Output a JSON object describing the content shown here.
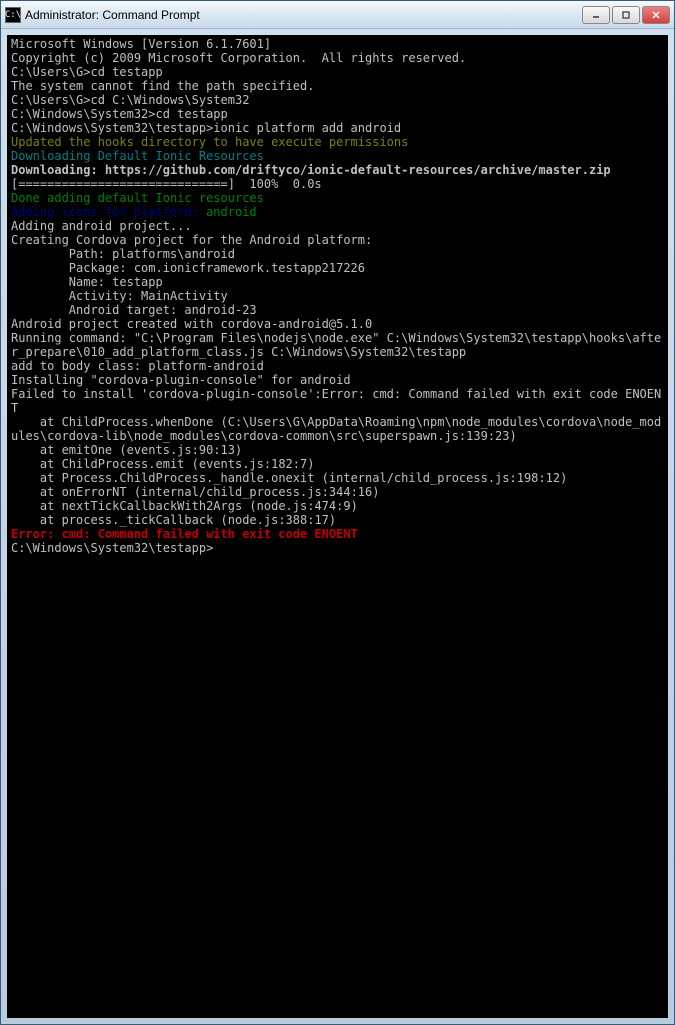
{
  "window": {
    "title": "Administrator: Command Prompt",
    "icon_label": "C:\\"
  },
  "terminal": {
    "lines": [
      {
        "cls": "c-white",
        "text": "Microsoft Windows [Version 6.1.7601]"
      },
      {
        "cls": "c-white",
        "text": "Copyright (c) 2009 Microsoft Corporation.  All rights reserved."
      },
      {
        "cls": "c-white",
        "text": ""
      },
      {
        "cls": "c-white",
        "text": "C:\\Users\\G>cd testapp"
      },
      {
        "cls": "c-white",
        "text": "The system cannot find the path specified."
      },
      {
        "cls": "c-white",
        "text": ""
      },
      {
        "cls": "c-white",
        "text": "C:\\Users\\G>cd C:\\Windows\\System32"
      },
      {
        "cls": "c-white",
        "text": ""
      },
      {
        "cls": "c-white",
        "text": "C:\\Windows\\System32>cd testapp"
      },
      {
        "cls": "c-white",
        "text": ""
      },
      {
        "cls": "c-white",
        "text": "C:\\Windows\\System32\\testapp>ionic platform add android"
      },
      {
        "cls": "c-yellow",
        "text": "Updated the hooks directory to have execute permissions"
      },
      {
        "cls": "c-cyan",
        "text": "Downloading Default Ionic Resources"
      },
      {
        "cls": "c-white bold",
        "text": "Downloading: https://github.com/driftyco/ionic-default-resources/archive/master.zip"
      },
      {
        "cls": "c-white",
        "text": "[=============================]  100%  0.0s"
      },
      {
        "cls": "c-green",
        "text": "Done adding default Ionic resources"
      },
      {
        "cls": "c-blue",
        "parts": [
          {
            "cls": "c-blue",
            "text": "Adding icons for platform: "
          },
          {
            "cls": "c-green",
            "text": "android"
          }
        ]
      },
      {
        "cls": "c-white",
        "text": "Adding android project..."
      },
      {
        "cls": "c-white",
        "text": "Creating Cordova project for the Android platform:"
      },
      {
        "cls": "c-white",
        "text": "        Path: platforms\\android"
      },
      {
        "cls": "c-white",
        "text": "        Package: com.ionicframework.testapp217226"
      },
      {
        "cls": "c-white",
        "text": "        Name: testapp"
      },
      {
        "cls": "c-white",
        "text": "        Activity: MainActivity"
      },
      {
        "cls": "c-white",
        "text": "        Android target: android-23"
      },
      {
        "cls": "c-white",
        "text": "Android project created with cordova-android@5.1.0"
      },
      {
        "cls": "c-white",
        "text": "Running command: \"C:\\Program Files\\nodejs\\node.exe\" C:\\Windows\\System32\\testapp\\hooks\\after_prepare\\010_add_platform_class.js C:\\Windows\\System32\\testapp"
      },
      {
        "cls": "c-white",
        "text": "add to body class: platform-android"
      },
      {
        "cls": "c-white",
        "text": "Installing \"cordova-plugin-console\" for android"
      },
      {
        "cls": "c-white",
        "text": "Failed to install 'cordova-plugin-console':Error: cmd: Command failed with exit code ENOENT"
      },
      {
        "cls": "c-white",
        "text": "    at ChildProcess.whenDone (C:\\Users\\G\\AppData\\Roaming\\npm\\node_modules\\cordova\\node_modules\\cordova-lib\\node_modules\\cordova-common\\src\\superspawn.js:139:23)"
      },
      {
        "cls": "c-white",
        "text": ""
      },
      {
        "cls": "c-white",
        "text": "    at emitOne (events.js:90:13)"
      },
      {
        "cls": "c-white",
        "text": "    at ChildProcess.emit (events.js:182:7)"
      },
      {
        "cls": "c-white",
        "text": "    at Process.ChildProcess._handle.onexit (internal/child_process.js:198:12)"
      },
      {
        "cls": "c-white",
        "text": "    at onErrorNT (internal/child_process.js:344:16)"
      },
      {
        "cls": "c-white",
        "text": "    at nextTickCallbackWith2Args (node.js:474:9)"
      },
      {
        "cls": "c-white",
        "text": "    at process._tickCallback (node.js:388:17)"
      },
      {
        "cls": "c-red",
        "text": "Error: cmd: Command failed with exit code ENOENT"
      },
      {
        "cls": "c-white",
        "text": ""
      },
      {
        "cls": "c-white",
        "text": "C:\\Windows\\System32\\testapp>"
      }
    ]
  }
}
